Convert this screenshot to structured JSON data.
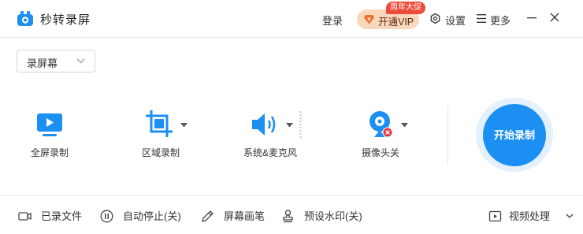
{
  "app": {
    "title": "秒转录屏",
    "brand_color": "#1b8ff2"
  },
  "titlebar": {
    "login_label": "登录",
    "vip_label": "开通VIP",
    "vip_badge": "周年大促",
    "settings_label": "设置",
    "more_label": "更多",
    "icons": [
      "app-logo-icon",
      "diamond-icon",
      "gear-icon",
      "menu-icon",
      "minimize-icon",
      "close-icon"
    ]
  },
  "mode_select": {
    "value": "录屏幕",
    "icon": "chevron-down-icon"
  },
  "tools": [
    {
      "label": "全屏录制",
      "icon": "monitor-play-icon"
    },
    {
      "label": "区域录制",
      "icon": "crop-icon"
    },
    {
      "label": "系统&麦克风",
      "icon": "speaker-icon"
    },
    {
      "label": "摄像头关",
      "icon": "webcam-off-icon"
    }
  ],
  "start_button": {
    "label": "开始录制"
  },
  "bottom": {
    "recorded_files": "已录文件",
    "auto_stop": "自动停止(关)",
    "screen_pen": "屏幕画笔",
    "watermark": "预设水印(关)",
    "video_processing": "视频处理"
  }
}
